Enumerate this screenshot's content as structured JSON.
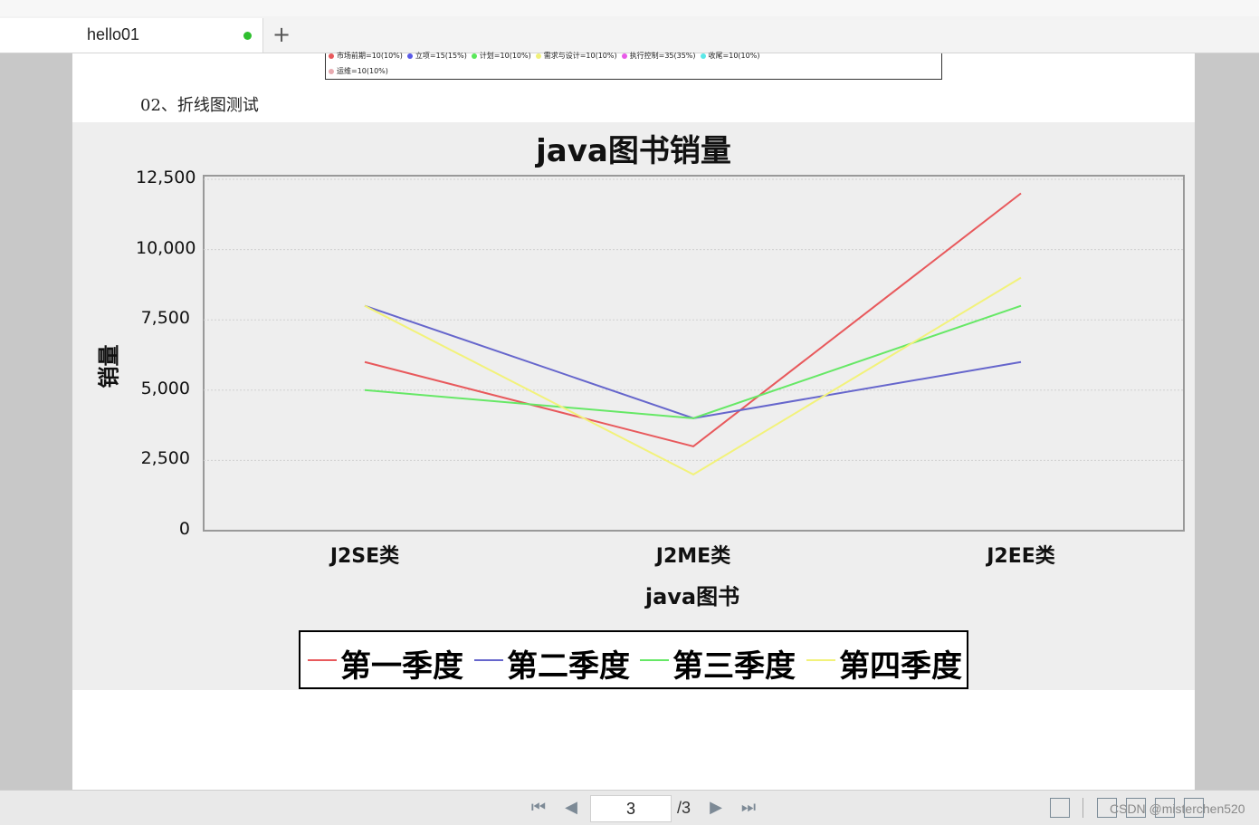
{
  "tab": {
    "title": "hello01",
    "add_label": "+"
  },
  "pie_legend": {
    "row1": [
      {
        "label": "市场前期=10(10%)",
        "color": "#e8595c"
      },
      {
        "label": "立项=15(15%)",
        "color": "#5a5ae8"
      },
      {
        "label": "计划=10(10%)",
        "color": "#5ae85a"
      },
      {
        "label": "需求与设计=10(10%)",
        "color": "#f0f07a"
      },
      {
        "label": "执行控制=35(35%)",
        "color": "#e85ae8"
      },
      {
        "label": "收尾=10(10%)",
        "color": "#5ae8e8"
      }
    ],
    "row2": [
      {
        "label": "运维=10(10%)",
        "color": "#e8aab0"
      }
    ]
  },
  "section_title": "02、折线图测试",
  "chart_data": {
    "type": "line",
    "title": "java图书销量",
    "xlabel": "java图书",
    "ylabel": "销量",
    "categories": [
      "J2SE类",
      "J2ME类",
      "J2EE类"
    ],
    "ylim": [
      0,
      12500
    ],
    "yticks": [
      "0",
      "2,500",
      "5,000",
      "7,500",
      "10,000",
      "12,500"
    ],
    "ytick_values": [
      0,
      2500,
      5000,
      7500,
      10000,
      12500
    ],
    "grid": true,
    "legend_position": "bottom",
    "series": [
      {
        "name": "第一季度",
        "values": [
          6000,
          3000,
          12000
        ],
        "color": "#e8595c"
      },
      {
        "name": "第二季度",
        "values": [
          8000,
          4000,
          6000
        ],
        "color": "#6666cc"
      },
      {
        "name": "第三季度",
        "values": [
          5000,
          4000,
          8000
        ],
        "color": "#66e866"
      },
      {
        "name": "第四季度",
        "values": [
          8000,
          2000,
          9000
        ],
        "color": "#f2f27a"
      }
    ]
  },
  "pager": {
    "current_page": "3",
    "total": "/3"
  },
  "watermark": "CSDN @misterchen520"
}
